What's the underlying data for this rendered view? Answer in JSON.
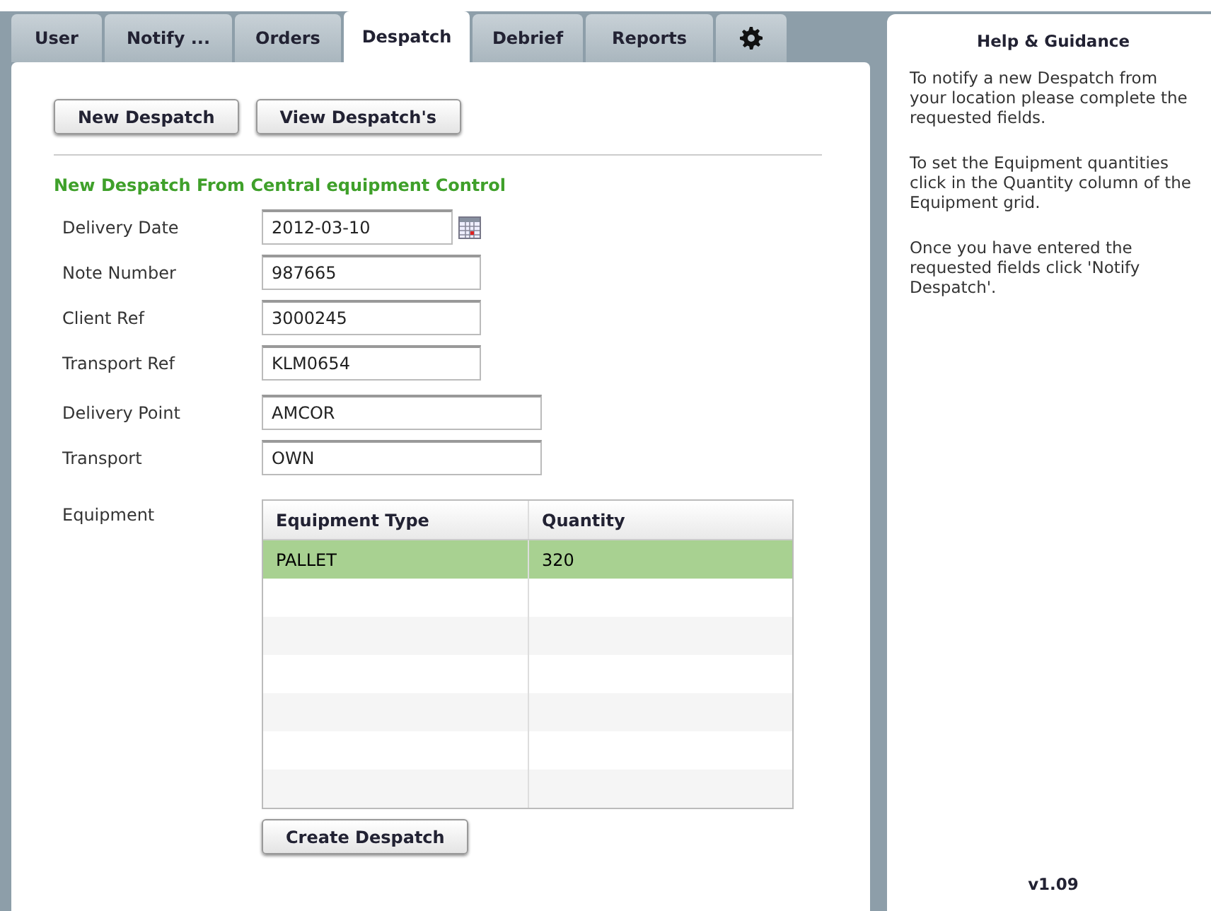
{
  "tabs": [
    {
      "label": "User",
      "selected": false
    },
    {
      "label": "Notify ...",
      "selected": false
    },
    {
      "label": "Orders",
      "selected": false
    },
    {
      "label": "Despatch",
      "selected": true
    },
    {
      "label": "Debrief",
      "selected": false
    },
    {
      "label": "Reports",
      "selected": false
    }
  ],
  "buttons": [
    "New Despatch",
    "View Despatch's"
  ],
  "section_title": "New Despatch From Central equipment Control",
  "reference_fields": [
    {
      "label": "Delivery Date",
      "value": "2012-03-10",
      "kind": "date"
    },
    {
      "label": "Note Number",
      "value": "987665",
      "kind": "text"
    },
    {
      "label": "Client Ref",
      "value": "3000245",
      "kind": "text"
    },
    {
      "label": "Transport Ref",
      "value": "KLM0654",
      "kind": "text"
    }
  ],
  "delivery_fields": [
    {
      "label": "Delivery Point",
      "value": "AMCOR",
      "kind": "wide"
    },
    {
      "label": "Transport",
      "value": "OWN",
      "kind": "wide"
    }
  ],
  "equipment": {
    "label": "Equipment",
    "columns": [
      "Equipment Type",
      "Quantity"
    ],
    "rows": [
      {
        "type": "PALLET",
        "quantity": "320",
        "selected": true
      }
    ]
  },
  "create_button": "Create Despatch",
  "help": {
    "title": "Help & Guidance",
    "paragraphs": [
      "To notify a new Despatch from your location please complete the requested fields.",
      "To set the Equipment quantities click in the Quantity column of the Equipment grid.",
      "Once you have entered the requested fields click 'Notify Despatch'."
    ],
    "version": "v1.09"
  }
}
